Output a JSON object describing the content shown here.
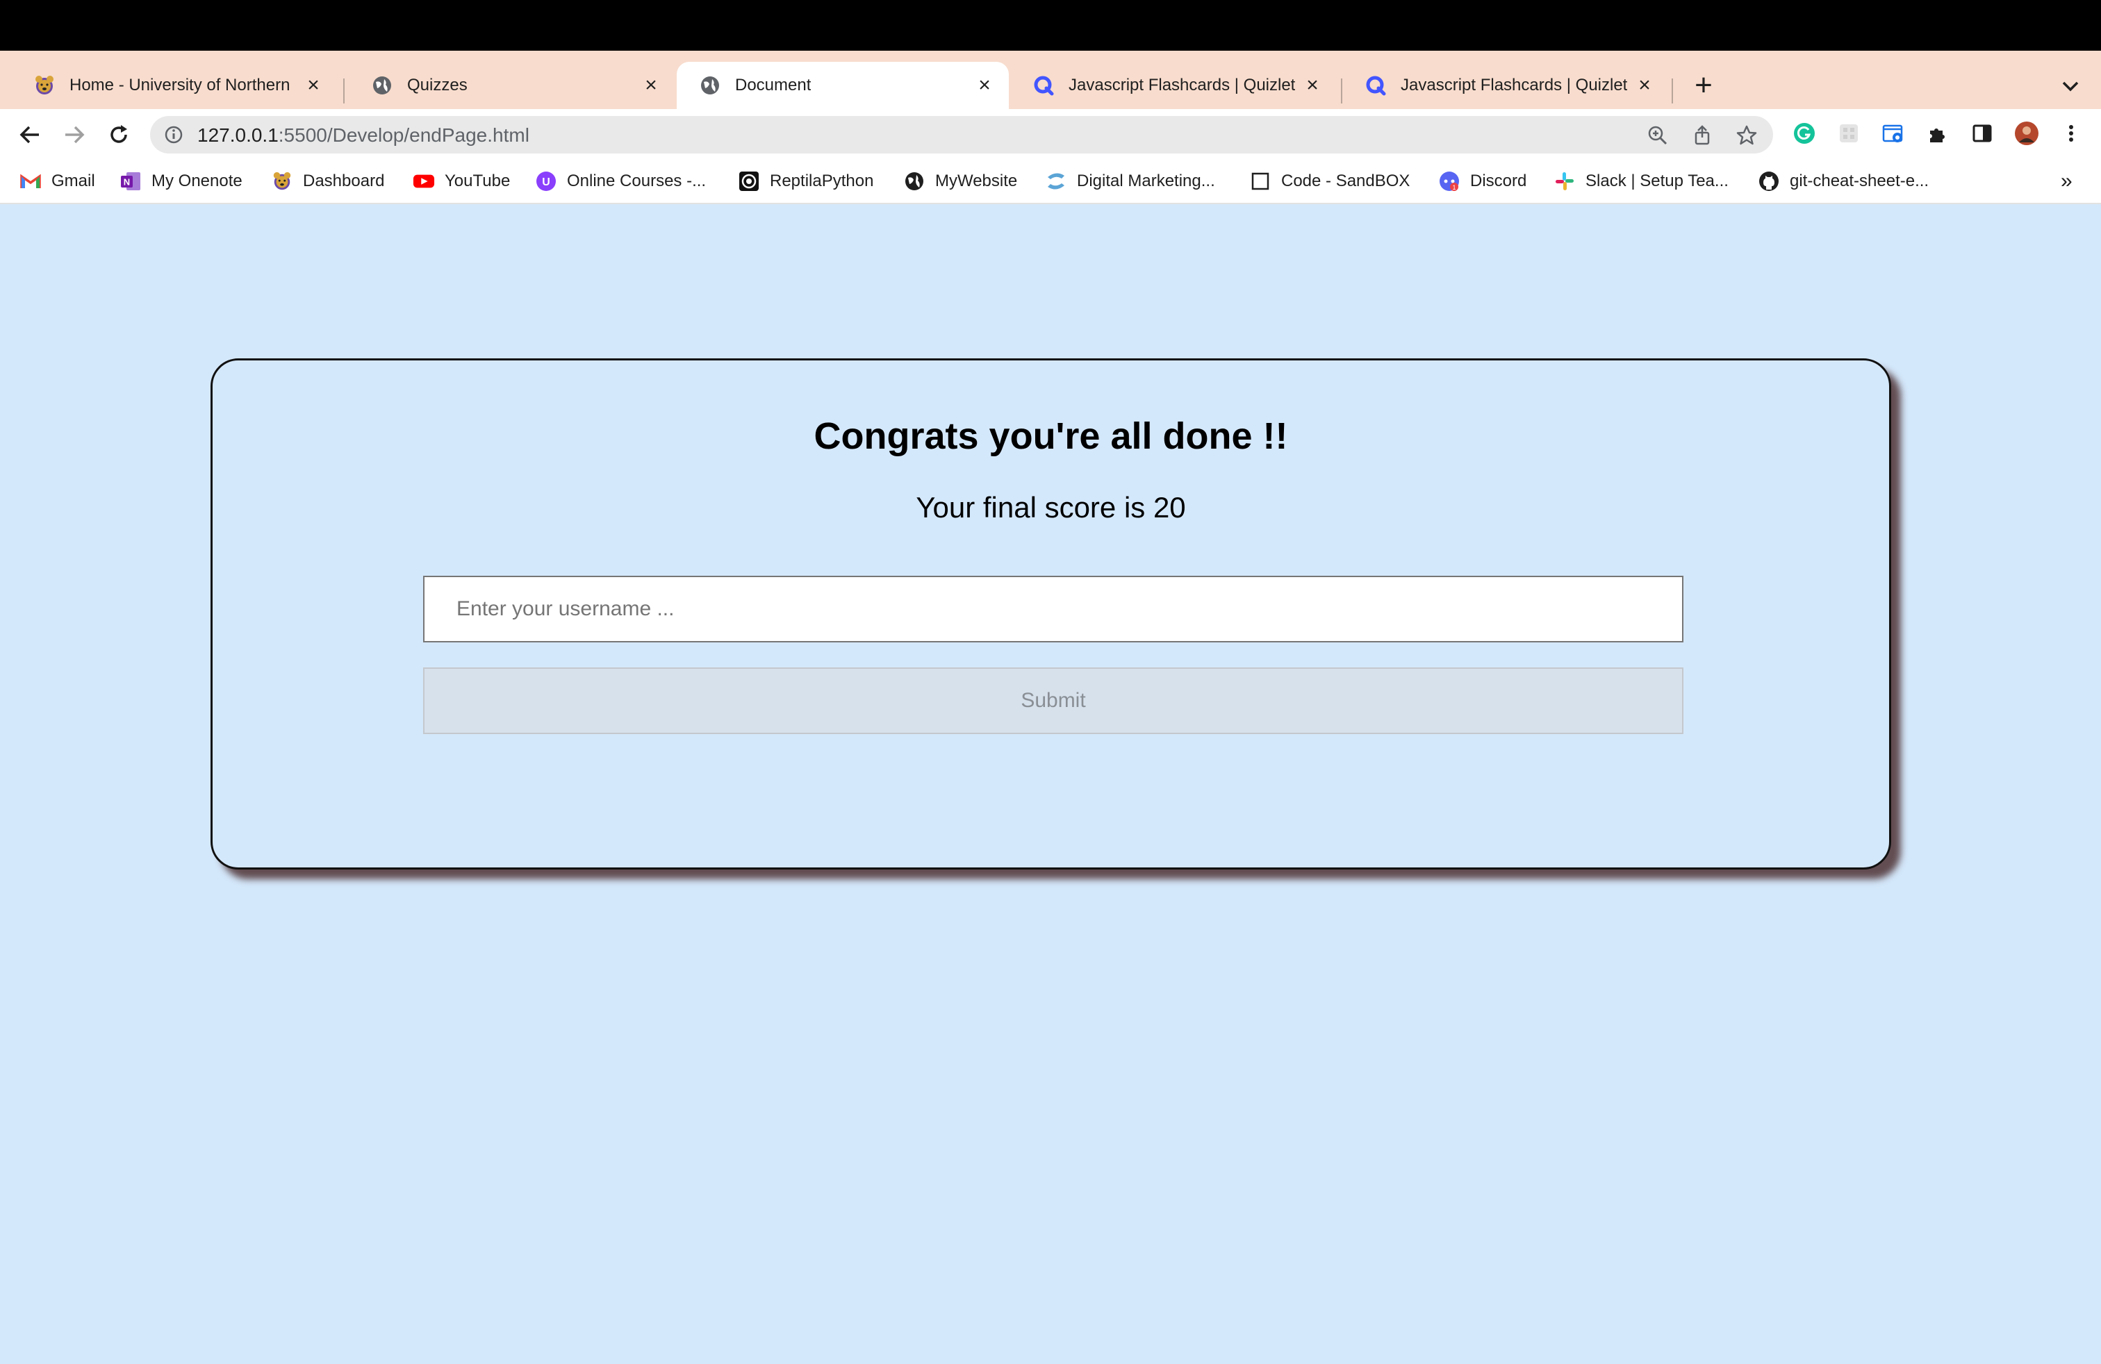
{
  "browser": {
    "tabs": [
      {
        "title": "Home - University of Northern",
        "icon": "university-bear-icon",
        "active": false
      },
      {
        "title": "Quizzes",
        "icon": "globe-icon",
        "active": false
      },
      {
        "title": "Document",
        "icon": "globe-icon",
        "active": true
      },
      {
        "title": "Javascript Flashcards | Quizlet",
        "icon": "quizlet-icon",
        "active": false
      },
      {
        "title": "Javascript Flashcards | Quizlet",
        "icon": "quizlet-icon",
        "active": false
      }
    ],
    "new_tab_label": "+",
    "close_glyph": "×",
    "url_host": "127.0.0.1",
    "url_path": ":5500/Develop/endPage.html",
    "bookmarks": [
      {
        "label": "Gmail",
        "icon": "gmail-icon"
      },
      {
        "label": "My Onenote",
        "icon": "onenote-icon"
      },
      {
        "label": "Dashboard",
        "icon": "university-bear-icon"
      },
      {
        "label": "YouTube",
        "icon": "youtube-icon"
      },
      {
        "label": "Online Courses -...",
        "icon": "online-courses-icon"
      },
      {
        "label": "ReptilaPython",
        "icon": "reptilapython-icon"
      },
      {
        "label": "MyWebsite",
        "icon": "globe-icon"
      },
      {
        "label": "Digital Marketing...",
        "icon": "digital-marketing-icon"
      },
      {
        "label": "Code - SandBOX",
        "icon": "blank-page-icon"
      },
      {
        "label": "Discord",
        "icon": "discord-icon"
      },
      {
        "label": "Slack | Setup Tea...",
        "icon": "slack-icon"
      },
      {
        "label": "git-cheat-sheet-e...",
        "icon": "github-icon"
      }
    ],
    "bookmarks_overflow": "»"
  },
  "page": {
    "heading": "Congrats you're all done !!",
    "score_text": "Your final score is 20",
    "username_placeholder": "Enter your username ...",
    "username_value": "",
    "submit_label": "Submit"
  },
  "colors": {
    "page_background": "#d4e8fb",
    "tabstrip_background": "#f8dccd",
    "card_shadow": "#3c1919"
  }
}
